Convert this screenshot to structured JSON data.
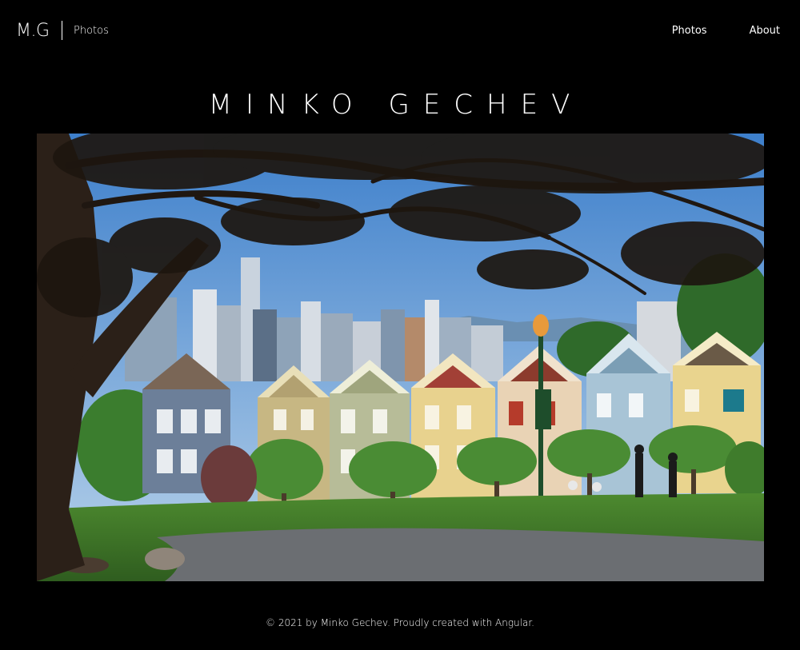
{
  "header": {
    "logo": "M.G",
    "section": "Photos",
    "nav": [
      {
        "label": "Photos"
      },
      {
        "label": "About"
      }
    ]
  },
  "site_title": "MINKO GECHEV",
  "hero": {
    "icon": "photo-painted-ladies-san-francisco",
    "colors": {
      "sky": "#6fa3d8",
      "grass": "#3f7a2a",
      "tree_trunk": "#2b2018"
    }
  },
  "footer": {
    "text": "© 2021 by Minko Gechev. Proudly created with Angular."
  }
}
